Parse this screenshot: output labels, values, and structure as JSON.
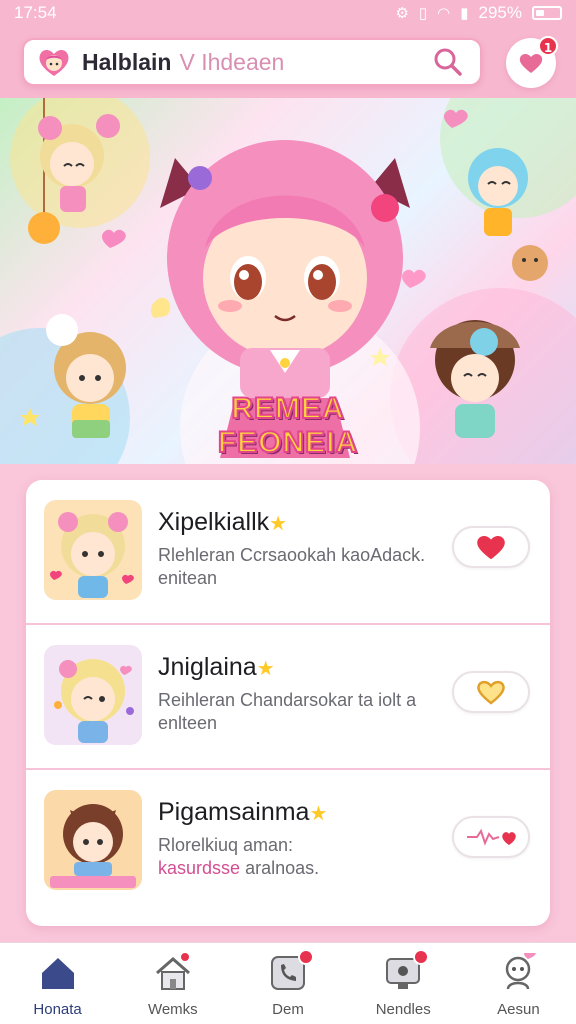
{
  "status_bar": {
    "time": "17:54",
    "battery": "295%"
  },
  "header": {
    "title": "Halblain",
    "search_placeholder": "V Ihdeaen",
    "favorites_badge": "1"
  },
  "banner": {
    "title": "REMEA FEONEIA"
  },
  "list": {
    "items": [
      {
        "title": "Xipelkiallk",
        "desc_line1": "Rlehleran Ccrsaookah kaoAdack.",
        "desc_line2": "enitean",
        "liked": true
      },
      {
        "title": "Jniglaina",
        "desc_line1": "Reihleran Chandarsokar ta iolt a",
        "desc_line2": "enlteen",
        "liked": false
      },
      {
        "title": "Pigamsainma",
        "desc_line1": "Rlorelkiuq aman:",
        "desc_line2a": "kasurdsse",
        "desc_line2b": "aralnoas.",
        "liked": false
      }
    ]
  },
  "bottom_nav": {
    "items": [
      {
        "label": "Honata",
        "icon": "home-icon"
      },
      {
        "label": "Wemks",
        "icon": "house-icon"
      },
      {
        "label": "Dem",
        "icon": "phone-icon"
      },
      {
        "label": "Nendles",
        "icon": "monitor-icon"
      },
      {
        "label": "Aesun",
        "icon": "character-icon"
      }
    ]
  },
  "colors": {
    "accent_pink": "#f7b7cf",
    "heart_red": "#e8334f",
    "heart_gold": "#f2b23a",
    "nav_active": "#2f3e7a"
  }
}
